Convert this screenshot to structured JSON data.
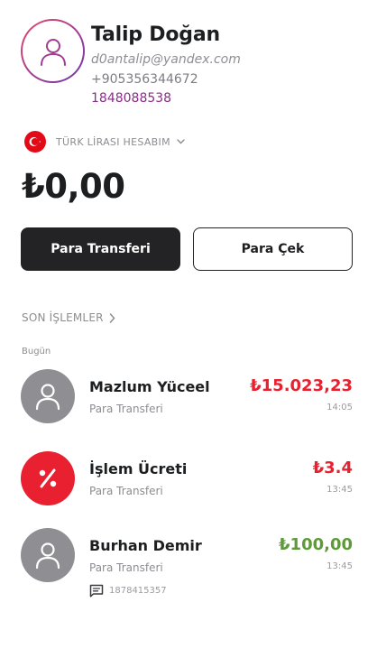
{
  "profile": {
    "name": "Talip Doğan",
    "email": "d0antalip@yandex.com",
    "phone": "+905356344672",
    "customer_id": "1848088538"
  },
  "account": {
    "name": "TÜRK LİRASI HESABIM",
    "balance": "₺0,00",
    "flag_color": "#e30a17"
  },
  "actions": {
    "transfer_label": "Para Transferi",
    "withdraw_label": "Para Çek"
  },
  "recent": {
    "title": "SON İŞLEMLER",
    "day_label": "Bugün",
    "transactions": [
      {
        "name": "Mazlum Yüceel",
        "type": "Para Transferi",
        "amount": "₺15.023,23",
        "time": "14:05",
        "direction": "outgoing",
        "icon": "user-icon"
      },
      {
        "name": "İşlem Ücreti",
        "type": "Para Transferi",
        "amount": "₺3.4",
        "time": "13:45",
        "direction": "outgoing",
        "icon": "percent-icon"
      },
      {
        "name": "Burhan Demir",
        "type": "Para Transferi",
        "amount": "₺100,00",
        "time": "13:45",
        "direction": "incoming",
        "icon": "user-icon",
        "note": "1878415357"
      }
    ]
  },
  "colors": {
    "negative": "#e8202f",
    "positive": "#5f9a3a",
    "dark": "#232326",
    "accent_purple": "#8a2d86"
  }
}
